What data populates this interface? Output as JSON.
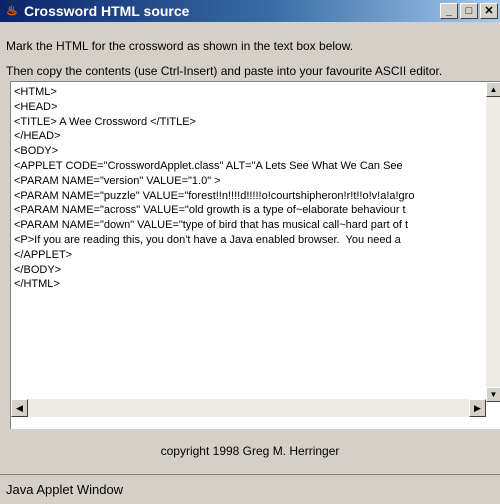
{
  "window": {
    "title": "Crossword HTML source",
    "controls": {
      "minimize": "_",
      "maximize": "□",
      "close": "✕"
    }
  },
  "instructions": {
    "line1": "Mark the HTML for the crossword as shown in the text box below.",
    "line2": "Then copy the contents (use Ctrl-Insert) and paste into your favourite ASCII editor."
  },
  "source_text": "<HTML>\n<HEAD>\n<TITLE> A Wee Crossword </TITLE>\n</HEAD>\n<BODY>\n<APPLET CODE=\"CrosswordApplet.class\" ALT=\"A Lets See What We Can See\n<PARAM NAME=\"version\" VALUE=\"1.0\" >\n<PARAM NAME=\"puzzle\" VALUE=\"forest!!n!!!!d!!!!!o!courtshipheron!r!t!!o!v!a!a!gro\n<PARAM NAME=\"across\" VALUE=\"old growth is a type of~elaborate behaviour t\n<PARAM NAME=\"down\" VALUE=\"type of bird that has musical call~hard part of t\n<P>If you are reading this, you don't have a Java enabled browser.  You need a\n</APPLET>\n</BODY>\n</HTML>",
  "copyright": "copyright 1998 Greg M. Herringer",
  "status": "Java Applet Window"
}
